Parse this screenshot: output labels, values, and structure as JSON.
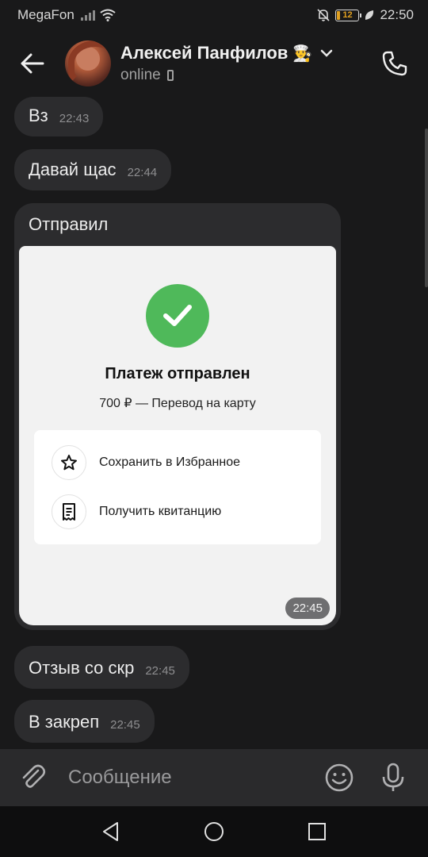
{
  "status_bar": {
    "carrier": "MegaFon",
    "battery": "12",
    "time": "22:50"
  },
  "header": {
    "contact_name": "Алексей Панфилов",
    "name_emoji": "👨‍🍳",
    "status": "online"
  },
  "messages": [
    {
      "text": "Вз",
      "time": "22:43"
    },
    {
      "text": "Давай щас",
      "time": "22:44"
    },
    {
      "text": "Отправил",
      "time": "22:45"
    },
    {
      "text": "Отзыв со скр",
      "time": "22:45"
    },
    {
      "text": "В закреп",
      "time": "22:45"
    }
  ],
  "payment_card": {
    "title": "Платеж отправлен",
    "subtitle": "700 ₽ — Перевод на карту",
    "actions": [
      {
        "label": "Сохранить в Избранное",
        "icon": "star-icon"
      },
      {
        "label": "Получить квитанцию",
        "icon": "receipt-icon"
      }
    ],
    "time": "22:45"
  },
  "input": {
    "placeholder": "Сообщение"
  },
  "colors": {
    "background": "#19191a",
    "bubble": "#2c2c2e",
    "success_green": "#4fb95a",
    "battery_low": "#e0a020"
  }
}
